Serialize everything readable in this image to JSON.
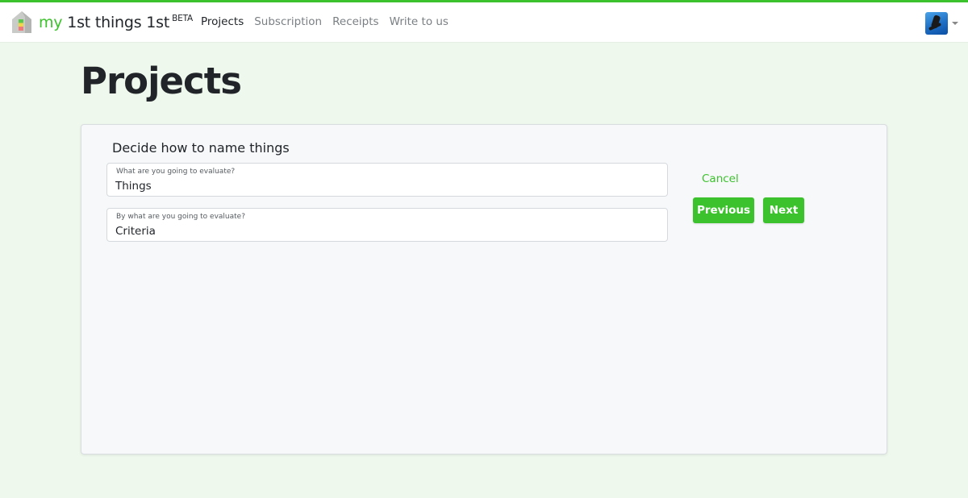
{
  "colors": {
    "accent": "#3cc22c",
    "background": "#eef8ec",
    "card_background": "#f7f8fa"
  },
  "navbar": {
    "brand": {
      "prefix": "my",
      "name": "1st things 1st",
      "badge": "BETA",
      "logo_icon": "house-priority-icon"
    },
    "links": [
      {
        "label": "Projects",
        "active": true
      },
      {
        "label": "Subscription",
        "active": false
      },
      {
        "label": "Receipts",
        "active": false
      },
      {
        "label": "Write to us",
        "active": false
      }
    ],
    "user_menu": {
      "avatar_icon": "user-avatar",
      "caret_icon": "caret-down-icon"
    }
  },
  "page": {
    "title": "Projects"
  },
  "card": {
    "title": "Decide how to name things",
    "fields": [
      {
        "label": "What are you going to evaluate?",
        "value": "Things"
      },
      {
        "label": "By what are you going to evaluate?",
        "value": "Criteria"
      }
    ],
    "actions": {
      "cancel": "Cancel",
      "previous": "Previous",
      "next": "Next"
    }
  }
}
